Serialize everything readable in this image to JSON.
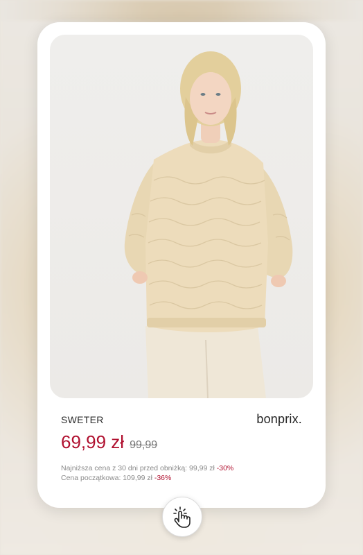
{
  "product": {
    "name": "SWETER",
    "brand": "bonprix.",
    "price": "69,99 zł",
    "old_price": "99,99",
    "lowest_price_label": "Najniższa cena z 30 dni  przed obniżką: 99,99 zł",
    "lowest_price_discount": "-30%",
    "initial_price_label": "Cena początkowa: 109,99 zł",
    "initial_price_discount": "-36%"
  },
  "icons": {
    "tap": "tap-hand-icon"
  },
  "colors": {
    "price": "#b0102f",
    "discount": "#b0102f"
  }
}
